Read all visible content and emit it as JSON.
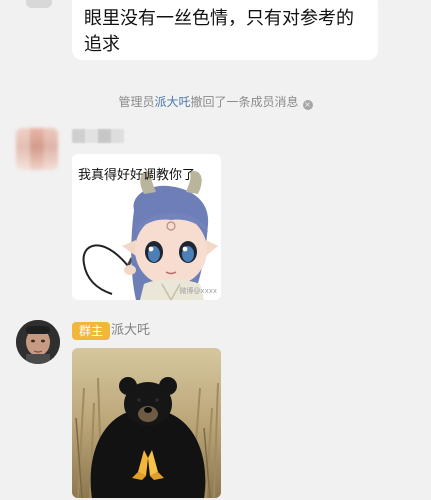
{
  "messages": {
    "top_bubble": {
      "text": "眼里没有一丝色情，只有对参考的追求"
    },
    "system_notice": {
      "prefix": "管理员",
      "admin_name": "派大吒",
      "suffix": "撤回了一条成员消息",
      "close_glyph": "×"
    },
    "sticker_message": {
      "caption": "我真得好好调教你了",
      "watermark": "微博@xxxx"
    },
    "owner_message": {
      "badge": "群主",
      "name": "派大吒"
    }
  },
  "colors": {
    "background": "#f1f1f1",
    "bubble": "#ffffff",
    "admin_link": "#4a78a8",
    "badge": "#f1b73c"
  }
}
